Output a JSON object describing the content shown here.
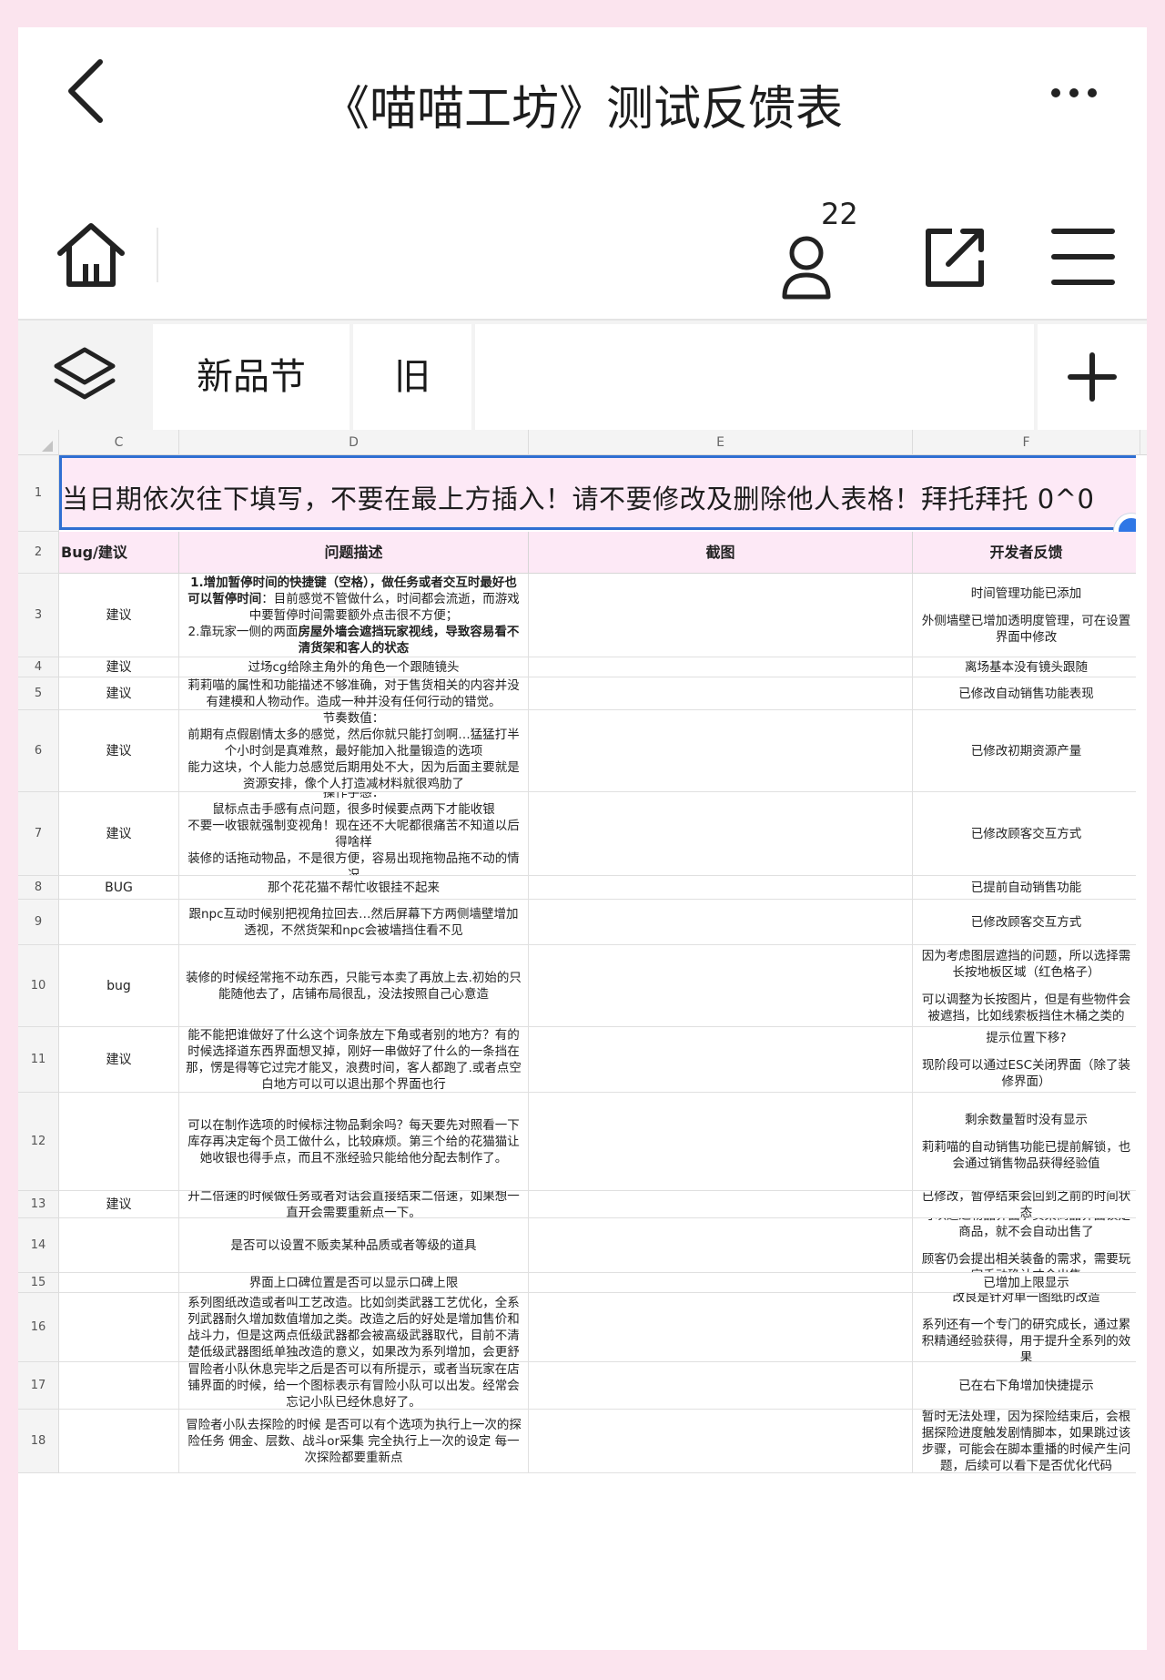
{
  "title": "《喵喵工坊》测试反馈表",
  "toolbar": {
    "collaborator_count": "22"
  },
  "sheet_tabs": [
    {
      "label": "新品节"
    },
    {
      "label": "旧"
    }
  ],
  "column_headers": [
    "C",
    "D",
    "E",
    "F"
  ],
  "banner": {
    "row": "1",
    "text": "当日期依次往下填写，不要在最上方插入！请不要修改及删除他人表格！拜托拜托 0^0"
  },
  "table_header": {
    "row": "2",
    "type": "Bug/建议",
    "desc": "问题描述",
    "shot": "截图",
    "reply": "开发者反馈"
  },
  "rows": [
    {
      "num": "3",
      "type": "建议",
      "desc": [
        {
          "b": "1.增加暂停时间的快捷键（空格），做任务或者交互时最好也可以暂停时间",
          "t": "：目前感觉不管做什么，时间都会流逝，而游戏中要暂停时间需要额外点击很不方便；"
        },
        {
          "t": "2.靠玩家一侧的两面",
          "b": "房屋外墙会遮挡玩家视线，导致容易看不清货架和客人的状态"
        }
      ],
      "reply": [
        "时间管理功能已添加",
        "外侧墙壁已增加透明度管理，可在设置界面中修改"
      ]
    },
    {
      "num": "4",
      "type": "建议",
      "desc": [
        {
          "t": "过场cg给除主角外的角色一个跟随镜头"
        }
      ],
      "reply": [
        "离场基本没有镜头跟随"
      ]
    },
    {
      "num": "5",
      "type": "建议",
      "desc": [
        {
          "t": "莉莉喵的属性和功能描述不够准确，对于售货相关的内容并没有建模和人物动作。造成一种并没有任何行动的错觉。"
        }
      ],
      "reply": [
        "已修改自动销售功能表现"
      ]
    },
    {
      "num": "6",
      "type": "建议",
      "desc": [
        {
          "t": "节奏数值："
        },
        {
          "t": "前期有点假剧情太多的感觉，然后你就只能打剑啊…猛猛打半个小时剑是真难熬，最好能加入批量锻造的选项"
        },
        {
          "t": "能力这块，个人能力总感觉后期用处不大，因为后面主要就是资源安排，像个人打造减材料就很鸡肋了"
        }
      ],
      "reply": [
        "已修改初期资源产量"
      ]
    },
    {
      "num": "7",
      "type": "建议",
      "desc": [
        {
          "t": "操作手感："
        },
        {
          "t": "鼠标点击手感有点问题，很多时候要点两下才能收银"
        },
        {
          "t": "不要一收银就强制变视角！现在还不大呢都很痛苦不知道以后得啥样"
        },
        {
          "t": "装修的话拖动物品，不是很方便，容易出现拖物品拖不动的情况"
        }
      ],
      "reply": [
        "已修改顾客交互方式"
      ]
    },
    {
      "num": "8",
      "type": "BUG",
      "desc": [
        {
          "t": "那个花花猫不帮忙收银挂不起来"
        }
      ],
      "reply": [
        "已提前自动销售功能"
      ]
    },
    {
      "num": "9",
      "type": "",
      "desc": [
        {
          "t": "跟npc互动时候别把视角拉回去…然后屏幕下方两侧墙壁增加透视，不然货架和npc会被墙挡住看不见"
        }
      ],
      "reply": [
        "已修改顾客交互方式"
      ]
    },
    {
      "num": "10",
      "type": "bug",
      "desc": [
        {
          "t": "装修的时候经常拖不动东西，只能亏本卖了再放上去.初始的只能随他去了，店铺布局很乱，没法按照自己心意造"
        }
      ],
      "reply": [
        "因为考虑图层遮挡的问题，所以选择需长按地板区域（红色格子）",
        "可以调整为长按图片，但是有些物件会被遮挡，比如线索板挡住木桶之类的"
      ]
    },
    {
      "num": "11",
      "type": "建议",
      "desc": [
        {
          "t": "能不能把谁做好了什么这个词条放左下角或者别的地方？有的时候选择道东西界面想叉掉，刚好一串做好了什么的一条挡在那，愣是得等它过完才能叉，浪费时间，客人都跑了.或者点空白地方可以可以退出那个界面也行"
        }
      ],
      "reply": [
        "提示位置下移?",
        "现阶段可以通过ESC关闭界面（除了装修界面）"
      ]
    },
    {
      "num": "12",
      "type": "",
      "desc": [
        {
          "t": "可以在制作选项的时候标注物品剩余吗？每天要先对照看一下库存再决定每个员工做什么，比较麻烦。第三个给的花猫猫让她收银也得手点，而且不涨经验只能给他分配去制作了。"
        }
      ],
      "reply": [
        "剩余数量暂时没有显示",
        "莉莉喵的自动销售功能已提前解锁，也会通过销售物品获得经验值"
      ]
    },
    {
      "num": "13",
      "type": "建议",
      "desc": [
        {
          "t": "开二倍速的时候做任务或者对话会直接结束二倍速，如果想一直开会需要重新点一下。"
        }
      ],
      "reply": [
        "已修改，暂停结束会回到之前的时间状态"
      ]
    },
    {
      "num": "14",
      "type": "",
      "desc": [
        {
          "t": "是否可以设置不贩卖某种品质或者等级的道具"
        }
      ],
      "reply": [
        "可以通过物品界面 / 货架商品界面锁定商品，就不会自动出售了",
        "顾客仍会提出相关装备的需求，需要玩家手动确认才会出售"
      ]
    },
    {
      "num": "15",
      "type": "",
      "desc": [
        {
          "t": "界面上口碑位置是否可以显示口碑上限"
        }
      ],
      "reply": [
        "已增加上限显示"
      ]
    },
    {
      "num": "16",
      "type": "",
      "desc": [
        {
          "t": "关于图纸改造。是否可以考虑将图纸改造从单独图纸改造改为系列图纸改造或者叫工艺改造。比如剑类武器工艺优化，全系列武器耐久增加数值增加之类。改造之后的好处是增加售价和战斗力，但是这两点低级武器都会被高级武器取代，目前不清楚低级武器图纸单独改造的意义，如果改为系列增加，会更舒服一些。"
        }
      ],
      "reply": [
        "改良是针对单一图纸的改造",
        "系列还有一个专门的研究成长，通过累积精通经验获得，用于提升全系列的效果"
      ]
    },
    {
      "num": "17",
      "type": "",
      "desc": [
        {
          "t": "冒险者小队休息完毕之后是否可以有所提示，或者当玩家在店铺界面的时候，给一个图标表示有冒险小队可以出发。经常会忘记小队已经休息好了。"
        }
      ],
      "reply": [
        "已在右下角增加快捷提示"
      ]
    },
    {
      "num": "18",
      "type": "",
      "desc": [
        {
          "t": "冒险者小队去探险的时候 是否可以有个选项为执行上一次的探险任务 佣金、层数、战斗or采集 完全执行上一次的设定 每一次探险都要重新点"
        }
      ],
      "reply": [
        "暂时无法处理，因为探险结束后，会根据探险进度触发剧情脚本，如果跳过该步骤，可能会在脚本重播的时候产生问题，后续可以看下是否优化代码"
      ]
    }
  ]
}
